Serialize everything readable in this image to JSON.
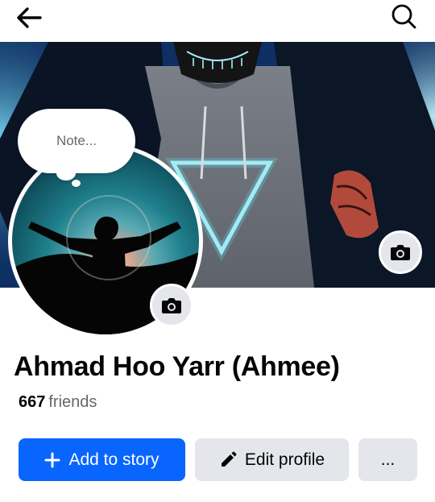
{
  "topbar": {
    "back_icon": "arrow-left-icon",
    "search_icon": "search-icon"
  },
  "profile": {
    "note_placeholder": "Note...",
    "name": "Ahmad Hoo Yarr (Ahmee)",
    "friends_count": "667",
    "friends_label": "friends"
  },
  "actions": {
    "add_to_story": "Add to story",
    "edit_profile": "Edit profile",
    "more": "..."
  },
  "colors": {
    "primary": "#0866ff",
    "secondary_bg": "#e4e6eb",
    "muted_text": "#65676b"
  }
}
